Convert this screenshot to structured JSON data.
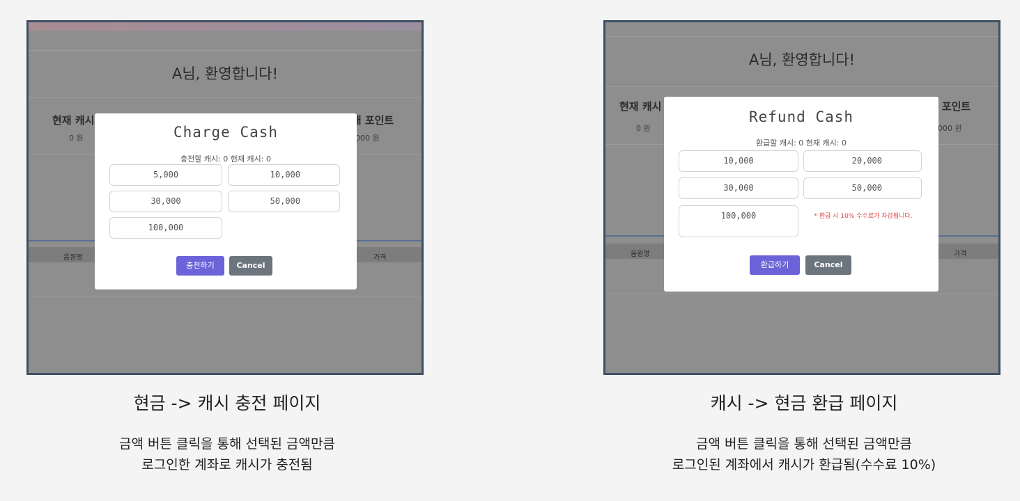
{
  "charge": {
    "welcome": "A님, 환영합니다!",
    "cash_label": "현재 캐시",
    "cash_value": "0 원",
    "point_label": "현재 포인트",
    "point_value": "1000 원",
    "col_left": "음원명",
    "col_right": "가격",
    "modal": {
      "title": "Charge Cash",
      "subtitle": "충전할 캐시: 0 현재 캐시: 0",
      "amounts": [
        "5,000",
        "10,000",
        "30,000",
        "50,000",
        "100,000"
      ],
      "submit_label": "충전하기",
      "cancel_label": "Cancel"
    },
    "caption": "현금 -> 캐시 충전 페이지",
    "desc_line1": "금액 버튼 클릭을 통해 선택된 금액만큼",
    "desc_line2": "로그인한 계좌로 캐시가 충전됨"
  },
  "refund": {
    "welcome": "A님, 환영합니다!",
    "cash_label": "현재 캐시",
    "cash_value": "0 원",
    "point_label": "현재 포인트",
    "point_value": "1000 원",
    "col_left": "음원명",
    "col_right": "가격",
    "modal": {
      "title": "Refund Cash",
      "subtitle": "환급할 캐시: 0 현재 캐시: 0",
      "amounts": [
        "10,000",
        "20,000",
        "30,000",
        "50,000",
        "100,000"
      ],
      "warning": "* 환급 시 10% 수수료가 차감됩니다.",
      "submit_label": "환급하기",
      "cancel_label": "Cancel"
    },
    "caption": "캐시 -> 현금 환급 페이지",
    "desc_line1": "금액 버튼 클릭을 통해 선택된 금액만큼",
    "desc_line2": "로그인된 계좌에서 캐시가 환급됨(수수료 10%)"
  },
  "colors": {
    "overlay": "#8e8e8e",
    "frame": "#3e5063",
    "primary_button": "#6b63d8",
    "cancel_button": "#6c757d",
    "warning_text": "#e04545"
  }
}
